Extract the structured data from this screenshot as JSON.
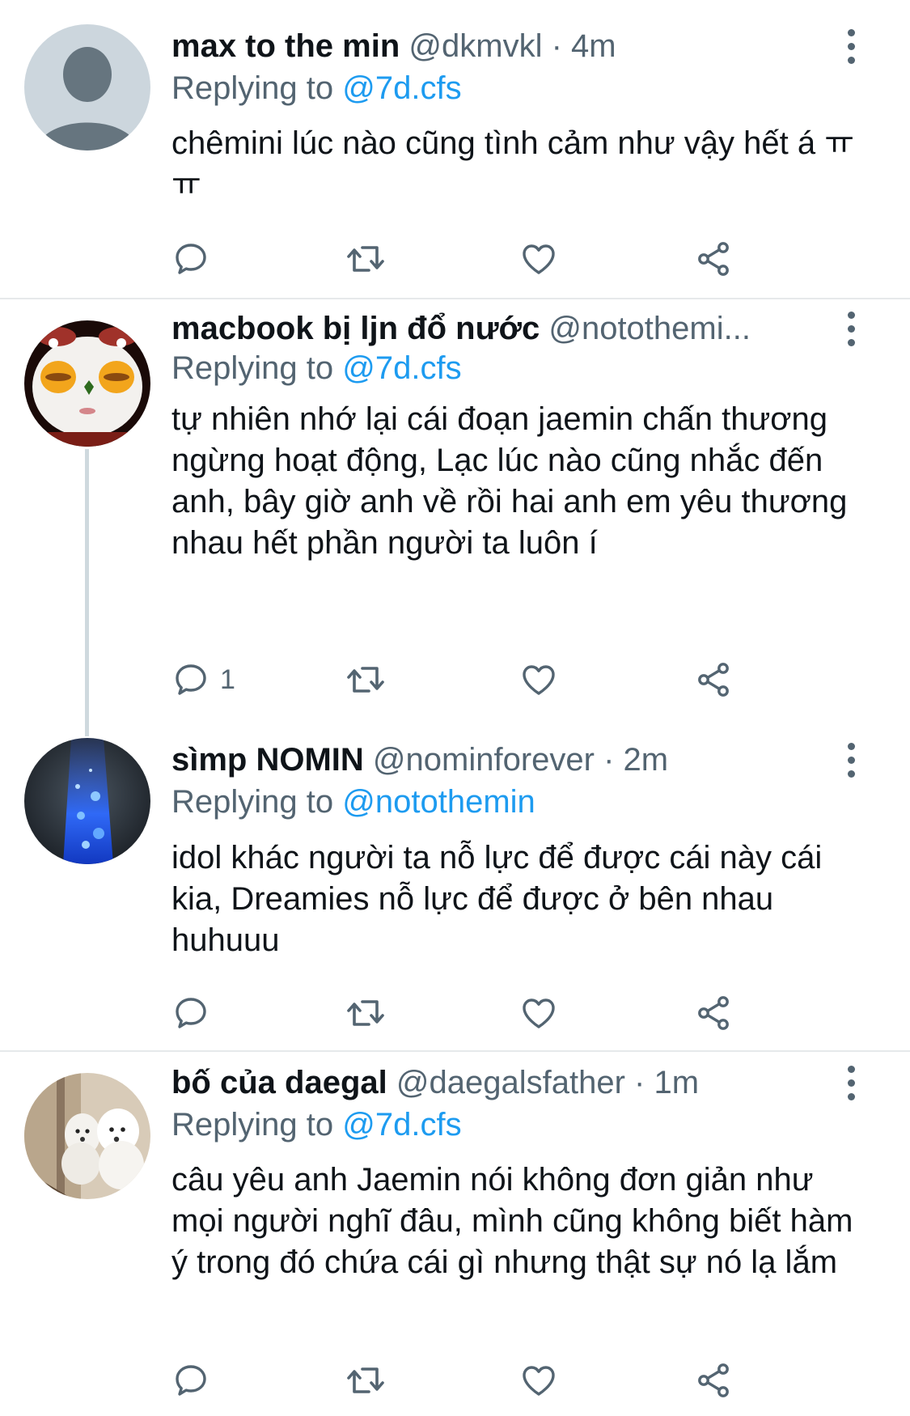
{
  "tweets": [
    {
      "name": "max to the min",
      "handle": "@dkmvkl",
      "dot": "·",
      "time": "4m",
      "replying_prefix": "Replying to",
      "replying_to": "@7d.cfs",
      "text": "chêmini lúc nào cũng tình cảm như vậy hết á ㅠㅠ",
      "reply_count": "",
      "avatar": "default-person-avatar"
    },
    {
      "name": "macbook bị ljn đổ nước",
      "handle": "@notothemi...",
      "dot": "",
      "time": "",
      "replying_prefix": "Replying to",
      "replying_to": "@7d.cfs",
      "text": "tự nhiên nhớ lại cái đoạn jaemin chấn thương ngừng hoạt động, Lạc lúc nào cũng nhắc đến anh, bây giờ anh về rồi hai anh em yêu thương nhau hết phần người ta luôn í",
      "reply_count": "1",
      "avatar": "character-face-avatar"
    },
    {
      "name": "sìmp NOMIN",
      "handle": "@nominforever",
      "dot": "·",
      "time": "2m",
      "replying_prefix": "Replying to",
      "replying_to": "@notothemin",
      "text": "idol khác người ta nỗ lực để được cái này cái kia, Dreamies nỗ lực để được ở bên nhau huhuuu",
      "reply_count": "",
      "avatar": "blue-sparkle-avatar"
    },
    {
      "name": "bố của daegal",
      "handle": "@daegalsfather",
      "dot": "·",
      "time": "1m",
      "replying_prefix": "Replying to",
      "replying_to": "@7d.cfs",
      "text": "câu yêu anh Jaemin nói không đơn giản như mọi người nghĩ đâu, mình cũng không biết hàm ý trong đó chứa cái gì nhưng thật sự nó lạ lắm",
      "reply_count": "",
      "avatar": "white-dogs-avatar"
    }
  ],
  "icons": {
    "reply": "reply-icon",
    "retweet": "retweet-icon",
    "like": "heart-icon",
    "share": "share-icon",
    "more": "more-vertical-icon"
  },
  "colors": {
    "name": "#0f1419",
    "secondary": "#536471",
    "mention": "#1d9bf0",
    "divider": "#e6e9eb",
    "thread_line": "#cfd9de"
  }
}
